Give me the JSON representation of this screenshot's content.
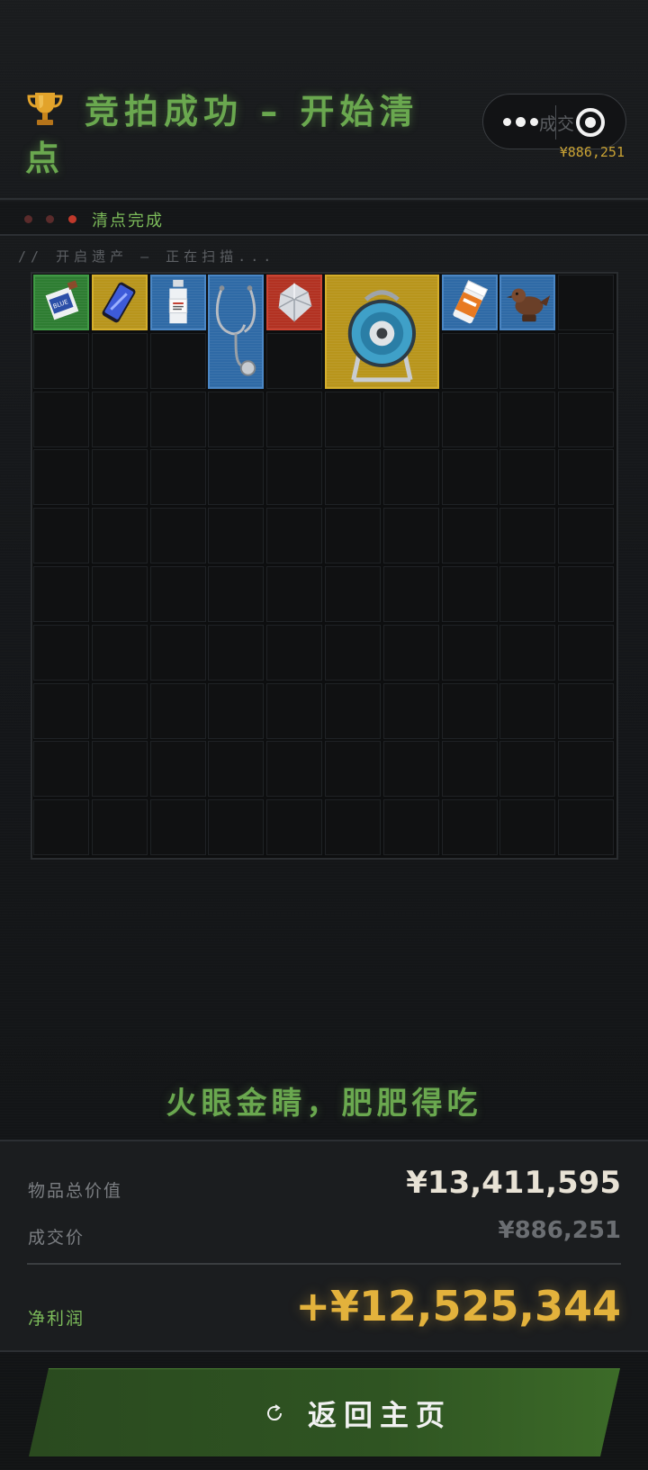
{
  "header": {
    "title": "竞拍成功 – 开始清点",
    "capsule_ghost": "成交",
    "deal_price": "¥886,251"
  },
  "status": {
    "text": "清点完成",
    "leds": [
      "#5a2b2b",
      "#5a2b2b",
      "#c0392b"
    ]
  },
  "scan": {
    "text": "// 开启遗产 – 正在扫描..."
  },
  "grid": {
    "cols": 10,
    "rows": 10,
    "items": [
      {
        "name": "energy-drink-item-icon",
        "col": 0,
        "row": 0,
        "w": 1,
        "h": 1,
        "rarity": "green"
      },
      {
        "name": "smartphone-item-icon",
        "col": 1,
        "row": 0,
        "w": 1,
        "h": 1,
        "rarity": "gold"
      },
      {
        "name": "medicine-bottle-item-icon",
        "col": 2,
        "row": 0,
        "w": 1,
        "h": 1,
        "rarity": "blue"
      },
      {
        "name": "stethoscope-item-icon",
        "col": 3,
        "row": 0,
        "w": 1,
        "h": 2,
        "rarity": "blue"
      },
      {
        "name": "diamond-item-icon",
        "col": 4,
        "row": 0,
        "w": 1,
        "h": 1,
        "rarity": "red"
      },
      {
        "name": "cable-reel-item-icon",
        "col": 5,
        "row": 0,
        "w": 2,
        "h": 2,
        "rarity": "gold"
      },
      {
        "name": "pill-bottle-item-icon",
        "col": 7,
        "row": 0,
        "w": 1,
        "h": 1,
        "rarity": "blue"
      },
      {
        "name": "bird-statue-item-icon",
        "col": 8,
        "row": 0,
        "w": 1,
        "h": 1,
        "rarity": "blue"
      }
    ]
  },
  "slogan": "火眼金睛，肥肥得吃",
  "summary": {
    "total_label": "物品总价值",
    "total_value": "¥13,411,595",
    "deal_label": "成交价",
    "deal_value": "¥886,251",
    "profit_label": "净利润",
    "profit_value": "+¥12,525,344"
  },
  "button": {
    "label": "返回主页"
  },
  "colors": {
    "accent_green": "#6aa84f",
    "accent_gold": "#e3b23c",
    "rarity_green": "#2e7d32",
    "rarity_gold": "#b8951c",
    "rarity_blue": "#2f6aa6",
    "rarity_red": "#b23222"
  }
}
